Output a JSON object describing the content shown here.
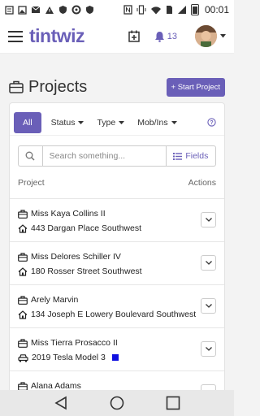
{
  "status_bar": {
    "time": "00:01",
    "left_icons": [
      "menu-lines-icon",
      "image-icon",
      "mail-icon",
      "alert-icon",
      "shield-icon",
      "settings-icon",
      "shield-icon"
    ],
    "right_icons": [
      "nfc-icon",
      "vibrate-icon",
      "wifi-icon",
      "sim-icon",
      "signal-icon",
      "battery-icon"
    ]
  },
  "app_bar": {
    "logo": "tintwiz",
    "notification_count": "13",
    "accent_color": "#6a5fb8"
  },
  "page": {
    "title": "Projects",
    "start_button": "+ Start Project"
  },
  "filters": {
    "all": "All",
    "status": "Status",
    "type": "Type",
    "mob_ins": "Mob/Ins"
  },
  "search": {
    "placeholder": "Search something...",
    "fields_label": "Fields"
  },
  "list": {
    "col_project": "Project",
    "col_actions": "Actions",
    "rows": [
      {
        "name": "Miss Kaya Collins II",
        "detail": "443 Dargan Place Southwest",
        "detail_icon": "home-icon"
      },
      {
        "name": "Miss Delores Schiller IV",
        "detail": "180 Rosser Street Southwest",
        "detail_icon": "home-icon"
      },
      {
        "name": "Arely Marvin",
        "detail": "134 Joseph E Lowery Boulevard Southwest",
        "detail_icon": "home-icon"
      },
      {
        "name": "Miss Tierra Prosacco II",
        "detail": "2019 Tesla Model 3",
        "detail_icon": "car-icon",
        "swatch": "#1010e0"
      },
      {
        "name": "Alana Adams",
        "detail": "",
        "detail_icon": ""
      }
    ]
  }
}
